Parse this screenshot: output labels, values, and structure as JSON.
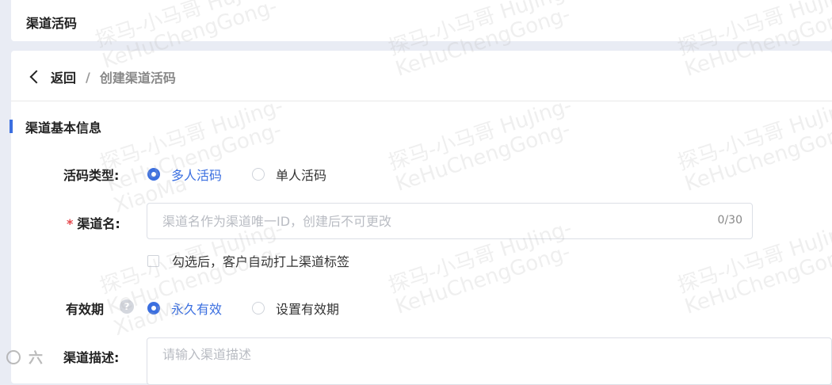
{
  "header": {
    "title": "渠道活码"
  },
  "breadcrumb": {
    "back": "返回",
    "separator": "/",
    "current": "创建渠道活码"
  },
  "section": {
    "title": "渠道基本信息"
  },
  "form": {
    "code_type": {
      "label": "活码类型:",
      "options": [
        {
          "label": "多人活码",
          "checked": true
        },
        {
          "label": "单人活码",
          "checked": false
        }
      ]
    },
    "channel_name": {
      "required_mark": "*",
      "label": "渠道名:",
      "placeholder": "渠道名作为渠道唯一ID，创建后不可更改",
      "counter": "0/30"
    },
    "auto_tag": {
      "label": "勾选后，客户自动打上渠道标签",
      "checked": false
    },
    "validity": {
      "label": "有效期",
      "help_icon": "question-icon",
      "help_glyph": "?",
      "options": [
        {
          "label": "永久有效",
          "checked": true
        },
        {
          "label": "设置有效期",
          "checked": false
        }
      ]
    },
    "description": {
      "label": "渠道描述:",
      "placeholder": "请输入渠道描述"
    }
  },
  "watermark": {
    "line1": "探马-小马哥 HuJing-",
    "line2": "KeHuChengGong-",
    "line3": "XiaoMa"
  },
  "corner_logo": {
    "text": "六"
  },
  "colors": {
    "accent": "#3b6fe0",
    "required": "#e5484d",
    "background": "#e9ecf4"
  }
}
